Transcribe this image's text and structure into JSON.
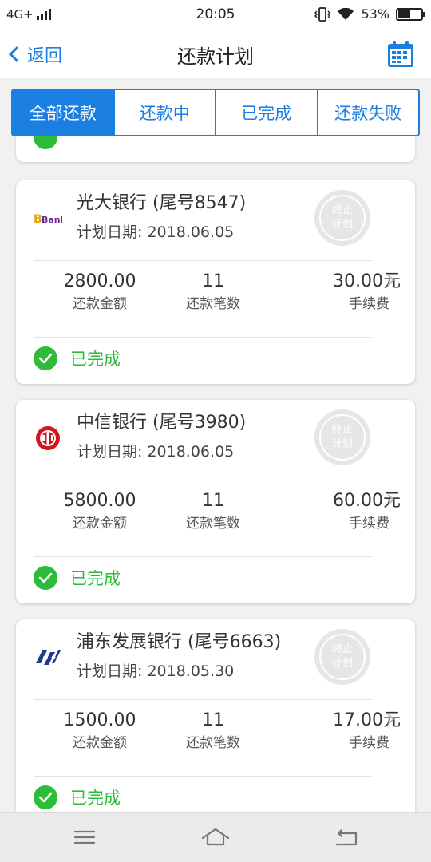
{
  "status_bar": {
    "network": "4G+",
    "time": "20:05",
    "battery": "53%",
    "battery_level": 0.53
  },
  "nav": {
    "back_label": "返回",
    "title": "还款计划"
  },
  "tabs": [
    {
      "label": "全部还款",
      "active": true
    },
    {
      "label": "还款中",
      "active": false
    },
    {
      "label": "已完成",
      "active": false
    },
    {
      "label": "还款失败",
      "active": false
    }
  ],
  "stop_button": {
    "line1": "终止",
    "line2": "计划"
  },
  "stat_labels": {
    "amount": "还款金额",
    "count": "还款笔数",
    "fee": "手续费"
  },
  "cards": [
    {
      "bank_name": "光大银行",
      "tail": "(尾号8547)",
      "plan_date_label": "计划日期:",
      "plan_date": "2018.06.05",
      "amount": "2800.00",
      "count": "11",
      "fee": "30.00元",
      "status": "已完成",
      "logo": "bank-text-logo",
      "logo_text": "Bank"
    },
    {
      "bank_name": "中信银行",
      "tail": "(尾号3980)",
      "plan_date_label": "计划日期:",
      "plan_date": "2018.06.05",
      "amount": "5800.00",
      "count": "11",
      "fee": "60.00元",
      "status": "已完成",
      "logo": "citic-logo"
    },
    {
      "bank_name": "浦东发展银行",
      "tail": "(尾号6663)",
      "plan_date_label": "计划日期:",
      "plan_date": "2018.05.30",
      "amount": "1500.00",
      "count": "11",
      "fee": "17.00元",
      "status": "已完成",
      "logo": "spdb-logo"
    }
  ],
  "colors": {
    "accent": "#1a7fe0",
    "success": "#2dbb3a",
    "citic_red": "#d7141d",
    "spdb_navy": "#1f3a8a"
  }
}
